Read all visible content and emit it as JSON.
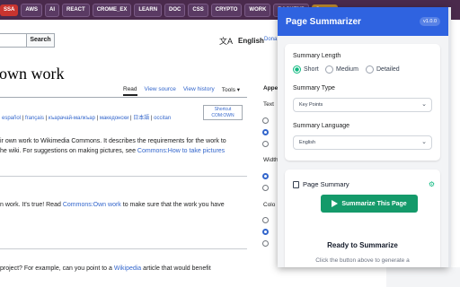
{
  "bookmarks": [
    {
      "label": "SSA",
      "color": "red"
    },
    {
      "label": "AWS",
      "color": "dark"
    },
    {
      "label": "AI",
      "color": "dark"
    },
    {
      "label": "REACT",
      "color": "dark"
    },
    {
      "label": "CROME_EX",
      "color": "dark"
    },
    {
      "label": "LEARN",
      "color": "dark"
    },
    {
      "label": "DOC",
      "color": "dark"
    },
    {
      "label": "CSS",
      "color": "dark"
    },
    {
      "label": "CRYPTO",
      "color": "dark"
    },
    {
      "label": "WORK",
      "color": "dark"
    },
    {
      "label": "BACKEND",
      "color": "dark"
    },
    {
      "label": "Course",
      "color": "gold"
    }
  ],
  "wiki": {
    "search_button": "Search",
    "language": "English",
    "donate": "Dona",
    "title": "own work",
    "tabs": {
      "read": "Read",
      "view_source": "View source",
      "view_history": "View history",
      "tools": "Tools"
    },
    "shortcut_line1": "Shortcut",
    "shortcut_line2": "COM:OWN",
    "languages": [
      "español",
      "français",
      "къарачай-малкъар",
      "македонски",
      "日本語",
      "occitan"
    ],
    "para1_line1": "ir own work to Wikimedia Commons. It describes the requirements for the work to",
    "para1_line2": "he wiki. For suggestions on making pictures, see",
    "para1_link": "Commons:How to take pictures",
    "para2_pre": "n work. It's true! Read",
    "para2_link": "Commons:Own work",
    "para2_post": "to make sure that the work you have",
    "para3_pre": "project? For example, can you point to a",
    "para3_link": "Wikipedia",
    "para3_post": "article that would benefit",
    "appearance": "Appe",
    "side_text": "Text",
    "side_width": "Width",
    "side_color": "Colo"
  },
  "popup": {
    "title": "Page Summarizer",
    "version": "v1.0.0",
    "summary_length_label": "Summary Length",
    "length_options": [
      "Short",
      "Medium",
      "Detailed"
    ],
    "length_selected": "Short",
    "summary_type_label": "Summary Type",
    "summary_type_value": "Key Points",
    "summary_language_label": "Summary Language",
    "summary_language_value": "English",
    "page_summary_label": "Page Summary",
    "summarize_button": "Summarize This Page",
    "ready_title": "Ready to Summarize",
    "ready_hint": "Click the button above to generate a"
  },
  "colors": {
    "header": "#2f63e0",
    "accent": "#149a6a",
    "link": "#3366cc"
  }
}
